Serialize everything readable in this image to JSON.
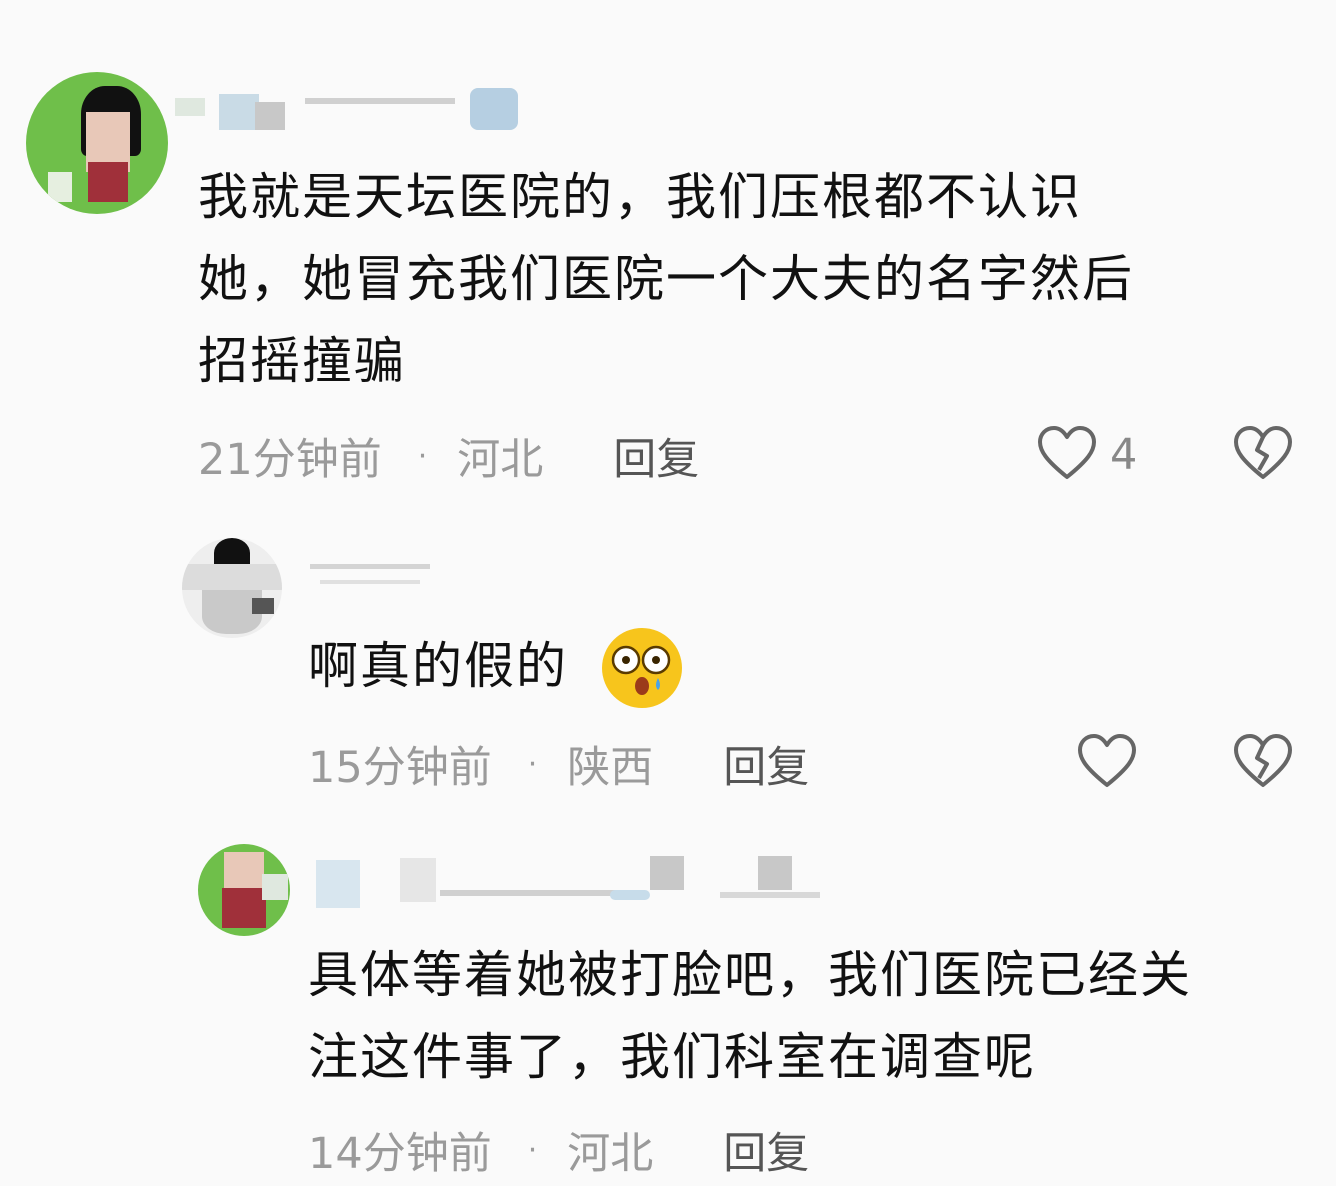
{
  "comments": [
    {
      "text_lines": [
        "我就是天坛医院的，我们压根都不认识",
        "她，她冒充我们医院一个大夫的名字然后",
        "招摇撞骗"
      ],
      "time": "21分钟前",
      "location": "河北",
      "reply": "回复",
      "likes": "4"
    },
    {
      "text_lines": [
        "啊真的假的"
      ],
      "emoji": "flushed-face",
      "time": "15分钟前",
      "location": "陕西",
      "reply": "回复"
    },
    {
      "text_lines": [
        "具体等着她被打脸吧，我们医院已经关",
        "注这件事了，我们科室在调查呢"
      ],
      "time": "14分钟前",
      "location": "河北",
      "reply": "回复"
    }
  ],
  "separator": "·",
  "colors": {
    "text": "#111111",
    "meta": "#9a9a9a",
    "avatar_green": "#6fbf4a"
  }
}
